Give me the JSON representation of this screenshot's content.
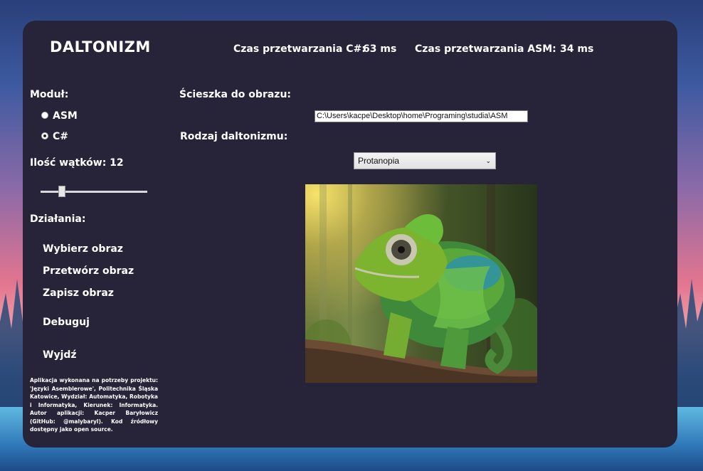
{
  "app": {
    "title": "DALTONIZM"
  },
  "timing": {
    "cs_label": "Czas przetwarzania C#:",
    "cs_value": "63 ms",
    "asm_label": "Czas przetwarzania ASM:",
    "asm_value": "34 ms"
  },
  "module": {
    "label": "Moduł:",
    "options": [
      {
        "label": "ASM",
        "selected": false
      },
      {
        "label": "C#",
        "selected": true
      }
    ]
  },
  "threads": {
    "label": "Ilość wątków: 12",
    "value": 12,
    "slider_fraction": 0.18
  },
  "actions": {
    "label": "Działania:",
    "items": [
      "Wybierz obraz",
      "Przetwórz obraz",
      "Zapisz obraz",
      "Debuguj",
      "Wyjdź"
    ]
  },
  "footnote": "Aplikacja wykonana na potrzeby projektu: 'Języki Asemblerowe', Politechnika Śląska Katowice, Wydział: Automatyka, Robotyka i Informatyka, Kierunek: Informatyka. Autor aplikacji: Kacper Baryłowicz (GitHub: @malybaryl). Kod źródłowy dostępny jako open source.",
  "path": {
    "label": "Ścieszka do obrazu:",
    "value": "C:\\Users\\kacpe\\Desktop\\home\\Programing\\studia\\ASM"
  },
  "daltonism": {
    "label": "Rodzaj daltonizmu:",
    "selected": "Protanopia"
  },
  "colors": {
    "panel_bg": "#27243a",
    "text": "#ffffff"
  }
}
